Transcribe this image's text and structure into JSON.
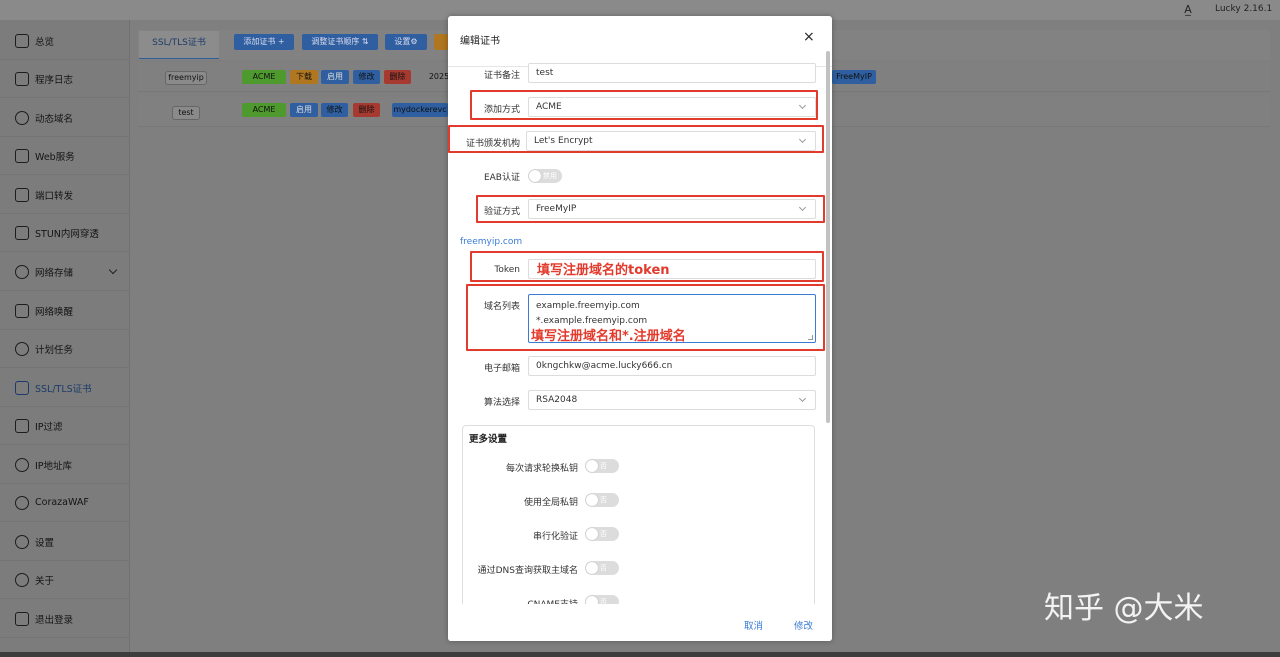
{
  "app": {
    "version": "Lucky 2.16.1",
    "lang_icon": "translate-icon"
  },
  "sidebar": {
    "items": [
      {
        "label": "总览",
        "icon": "dashboard-icon"
      },
      {
        "label": "程序日志",
        "icon": "log-icon"
      },
      {
        "label": "动态域名",
        "icon": "globe-icon"
      },
      {
        "label": "Web服务",
        "icon": "web-icon"
      },
      {
        "label": "端口转发",
        "icon": "port-forward-icon"
      },
      {
        "label": "STUN内网穿透",
        "icon": "stun-icon"
      },
      {
        "label": "网络存储",
        "icon": "cloud-icon"
      },
      {
        "label": "网络唤醒",
        "icon": "bell-icon"
      },
      {
        "label": "计划任务",
        "icon": "clock-icon"
      },
      {
        "label": "SSL/TLS证书",
        "icon": "certificate-icon"
      },
      {
        "label": "IP过滤",
        "icon": "filter-icon"
      },
      {
        "label": "IP地址库",
        "icon": "user-icon"
      },
      {
        "label": "CorazaWAF",
        "icon": "shield-icon"
      },
      {
        "label": "设置",
        "icon": "gear-icon"
      },
      {
        "label": "关于",
        "icon": "info-icon"
      },
      {
        "label": "退出登录",
        "icon": "logout-icon"
      }
    ]
  },
  "content": {
    "tab_label": "SSL/TLS证书",
    "toolbar": {
      "add_cert": "添加证书 +",
      "reorder": "调整证书顺序 ⇅",
      "settings": "设置⚙"
    },
    "rows": [
      {
        "name": "freemyip",
        "tags": [
          "ACME",
          "下载",
          "启用",
          "修改",
          "删除"
        ],
        "date": "2025",
        "provider": "FreeMyIP"
      },
      {
        "name": "test",
        "tags": [
          "ACME",
          "启用",
          "修改",
          "删除"
        ],
        "domain": "mydockerevc"
      }
    ]
  },
  "modal": {
    "title": "编辑证书",
    "close_icon": "×",
    "fields": {
      "remark_label": "证书备注",
      "remark_value": "test",
      "method_label": "添加方式",
      "method_value": "ACME",
      "ca_label": "证书颁发机构",
      "ca_value": "Let's Encrypt",
      "eab_label": "EAB认证",
      "eab_state": "禁用",
      "verify_label": "验证方式",
      "verify_value": "FreeMyIP",
      "provider_link": "freemyip.com",
      "token_label": "Token",
      "domains_label": "域名列表",
      "domains_value_1": "example.freemyip.com",
      "domains_value_2": "*.example.freemyip.com",
      "email_label": "电子邮箱",
      "email_value": "0kngchkw@acme.lucky666.cn",
      "algo_label": "算法选择",
      "algo_value": "RSA2048"
    },
    "more": {
      "title": "更多设置",
      "items": [
        {
          "label": "每次请求轮换私钥",
          "state": "否"
        },
        {
          "label": "使用全局私钥",
          "state": "否"
        },
        {
          "label": "串行化验证",
          "state": "否"
        },
        {
          "label": "通过DNS查询获取主域名",
          "state": "否"
        },
        {
          "label": "CNAME支持",
          "state": "否"
        }
      ]
    },
    "footer": {
      "cancel": "取消",
      "confirm": "修改"
    }
  },
  "annotations": {
    "token_note": "填写注册域名的token",
    "domains_note": "填写注册域名和*.注册域名"
  },
  "watermark": "知乎 @大米",
  "colors": {
    "accent": "#3a7bd5",
    "annotation": "#e23a2c"
  }
}
